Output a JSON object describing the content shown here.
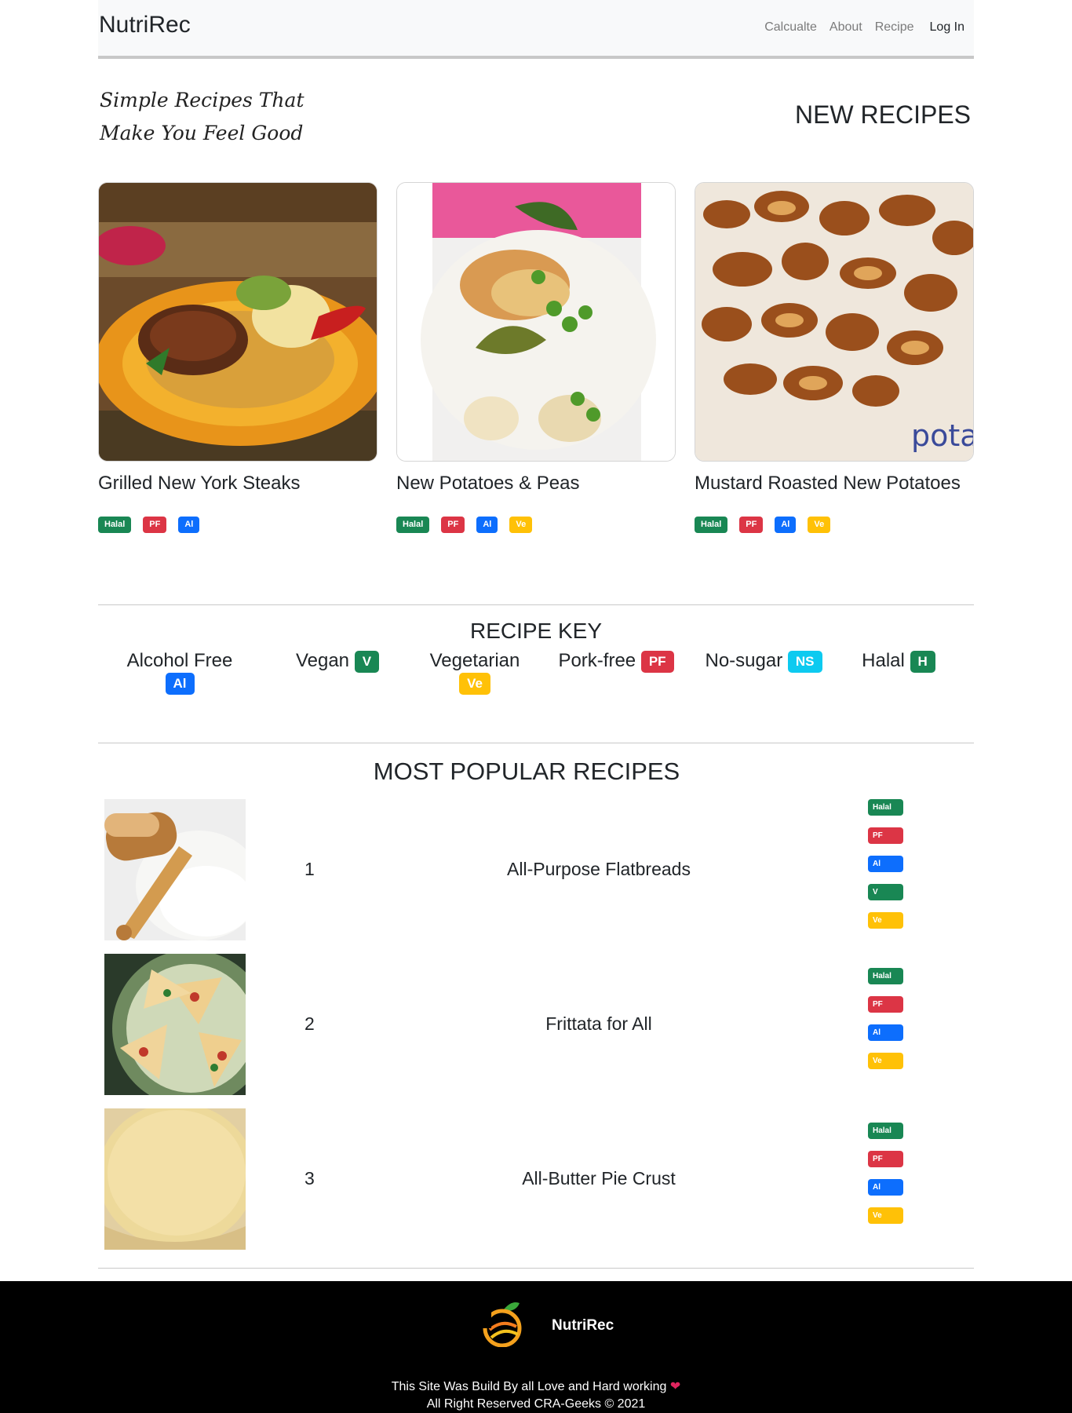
{
  "navbar": {
    "brand": "NutriRec",
    "links": [
      "Calcualte",
      "About",
      "Recipe"
    ],
    "login": "Log In"
  },
  "hero": {
    "tagline_line1": "Simple Recipes That",
    "tagline_line2": "Make You Feel Good",
    "new_recipes_heading": "NEW RECIPES"
  },
  "new_recipes": [
    {
      "title": "Grilled New York Steaks",
      "badges": [
        "Halal",
        "PF",
        "Al"
      ]
    },
    {
      "title": "New Potatoes & Peas",
      "badges": [
        "Halal",
        "PF",
        "Al",
        "Ve"
      ]
    },
    {
      "title": "Mustard Roasted New Potatoes",
      "badges": [
        "Halal",
        "PF",
        "Al",
        "Ve"
      ],
      "image_text": "pota"
    }
  ],
  "recipe_key": {
    "title": "RECIPE KEY",
    "items": [
      {
        "label": "Alcohol Free",
        "badge": "Al"
      },
      {
        "label": "Vegan",
        "badge": "V"
      },
      {
        "label": "Vegetarian",
        "badge": "Ve"
      },
      {
        "label": "Pork-free",
        "badge": "PF"
      },
      {
        "label": "No-sugar",
        "badge": "NS"
      },
      {
        "label": "Halal",
        "badge": "H"
      }
    ]
  },
  "popular": {
    "title": "MOST POPULAR RECIPES",
    "rows": [
      {
        "rank": "1",
        "name": "All-Purpose Flatbreads",
        "badges": [
          "Halal",
          "PF",
          "Al",
          "V",
          "Ve"
        ]
      },
      {
        "rank": "2",
        "name": "Frittata for All",
        "badges": [
          "Halal",
          "PF",
          "Al",
          "Ve"
        ]
      },
      {
        "rank": "3",
        "name": "All-Butter Pie Crust",
        "badges": [
          "Halal",
          "PF",
          "Al",
          "Ve"
        ]
      }
    ]
  },
  "footer": {
    "brand": "NutriRec",
    "line1": "This Site Was Build By all Love and Hard working",
    "line2": "All Right Reserved CRA-Geeks © 2021"
  },
  "colors": {
    "green": "#198754",
    "red": "#dc3545",
    "blue": "#0d6efd",
    "yellow": "#ffc107",
    "cyan": "#0dcaf0"
  }
}
